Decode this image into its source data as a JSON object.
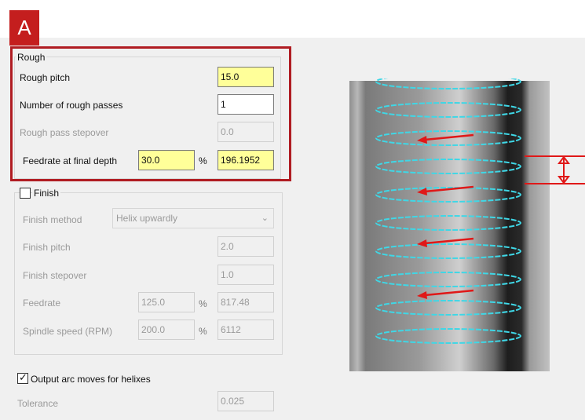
{
  "badge": "A",
  "rough": {
    "group_title": "Rough",
    "pitch_label": "Rough pitch",
    "pitch_value": "15.0",
    "passes_label": "Number of rough passes",
    "passes_value": "1",
    "stepover_label": "Rough pass stepover",
    "stepover_value": "0.0",
    "feedrate_label": "Feedrate at final depth",
    "feedrate_pct_value": "30.0",
    "feedrate_pct_symbol": "%",
    "feedrate_value": "196.1952"
  },
  "finish": {
    "checkbox_label": "Finish",
    "checked": false,
    "method_label": "Finish method",
    "method_value": "Helix upwardly",
    "pitch_label": "Finish pitch",
    "pitch_value": "2.0",
    "stepover_label": "Finish stepover",
    "stepover_value": "1.0",
    "feedrate_label": "Feedrate",
    "feedrate_pct_value": "125.0",
    "feedrate_pct_symbol": "%",
    "feedrate_value": "817.48",
    "spindle_label": "Spindle speed (RPM)",
    "spindle_pct_value": "200.0",
    "spindle_pct_symbol": "%",
    "spindle_value": "6112"
  },
  "output_arc": {
    "label": "Output arc moves for helixes",
    "checked": true
  },
  "tolerance": {
    "label": "Tolerance",
    "value": "0.025"
  },
  "viewport": {
    "helix_color": "#3fd7e6",
    "arrow_color": "#e01818",
    "helix_loops": 10,
    "arrows_count": 4
  }
}
